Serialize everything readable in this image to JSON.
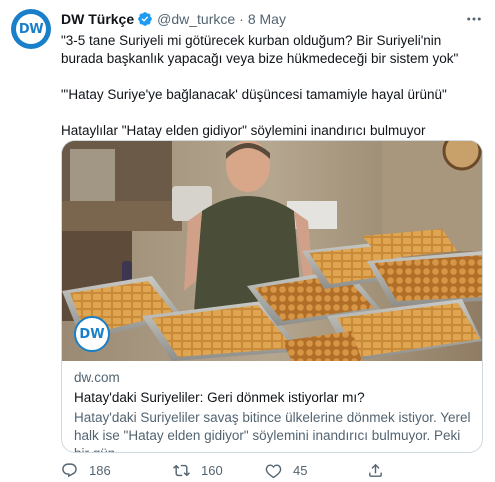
{
  "author": {
    "name": "DW Türkçe",
    "handle": "@dw_turkce",
    "separator": "·",
    "date": "8 May",
    "avatar_text": "DW",
    "verified": true
  },
  "more_icon": "more-dots-icon",
  "tweet": {
    "lines": [
      "\"3-5 tane Suriyeli mi götürecek kurban olduğum? Bir Suriyeli'nin burada başkanlık yapacağı veya bize hükmedeceği bir sistem yok\"",
      "\"'Hatay Suriye'ye bağlanacak' düşüncesi tamamiyle hayal ürünü\"",
      "Hataylılar \"Hatay elden gidiyor\" söylemini inandırıcı bulmuyor"
    ]
  },
  "card": {
    "logo_text": "DW",
    "domain": "dw.com",
    "title": "Hatay'daki Suriyeliler: Geri dönmek istiyorlar mı?",
    "description": "Hatay'daki Suriyeliler savaş bitince ülkelerine dönmek istiyor. Yerel halk ise \"Hatay elden gidiyor\" söylemini inandırıcı bulmuyor. Peki bir gün ..."
  },
  "actions": {
    "replies": "186",
    "retweets": "160",
    "likes": "45"
  },
  "colors": {
    "brand_blue": "#1a7fc9",
    "verified_blue": "#1d9bf0",
    "secondary_text": "#536471",
    "border": "#cfd9de"
  }
}
